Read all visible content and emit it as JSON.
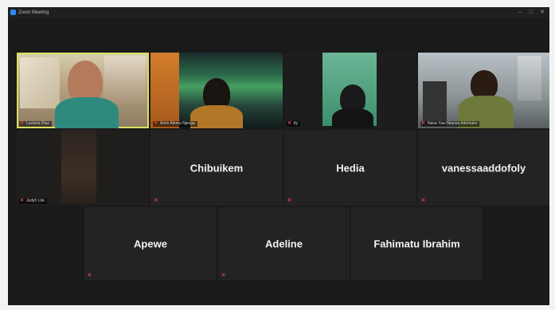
{
  "window": {
    "title": "Zoom Meeting"
  },
  "participants": [
    {
      "display_name": "Luciana Diaz"
    },
    {
      "display_name": "Amin Alemu Njenga"
    },
    {
      "display_name": "ity"
    },
    {
      "display_name": "Nana Yaa Nkansa Adomako"
    },
    {
      "display_name": "Judyh Lite"
    },
    {
      "display_name": "Chibuikem"
    },
    {
      "display_name": "Hedia"
    },
    {
      "display_name": "vanessaaddofoly"
    },
    {
      "display_name": "Apewe"
    },
    {
      "display_name": "Adeline"
    },
    {
      "display_name": "Fahimatu Ibrahim"
    }
  ],
  "icons": {
    "mic_off": "microphone-muted-icon",
    "window_minimize": "minimize-icon",
    "window_maximize": "maximize-icon",
    "window_close": "close-icon"
  },
  "colors": {
    "active_speaker_border": "#d8e25f",
    "muted_mic": "#e0454c",
    "tile_background": "#232323"
  }
}
